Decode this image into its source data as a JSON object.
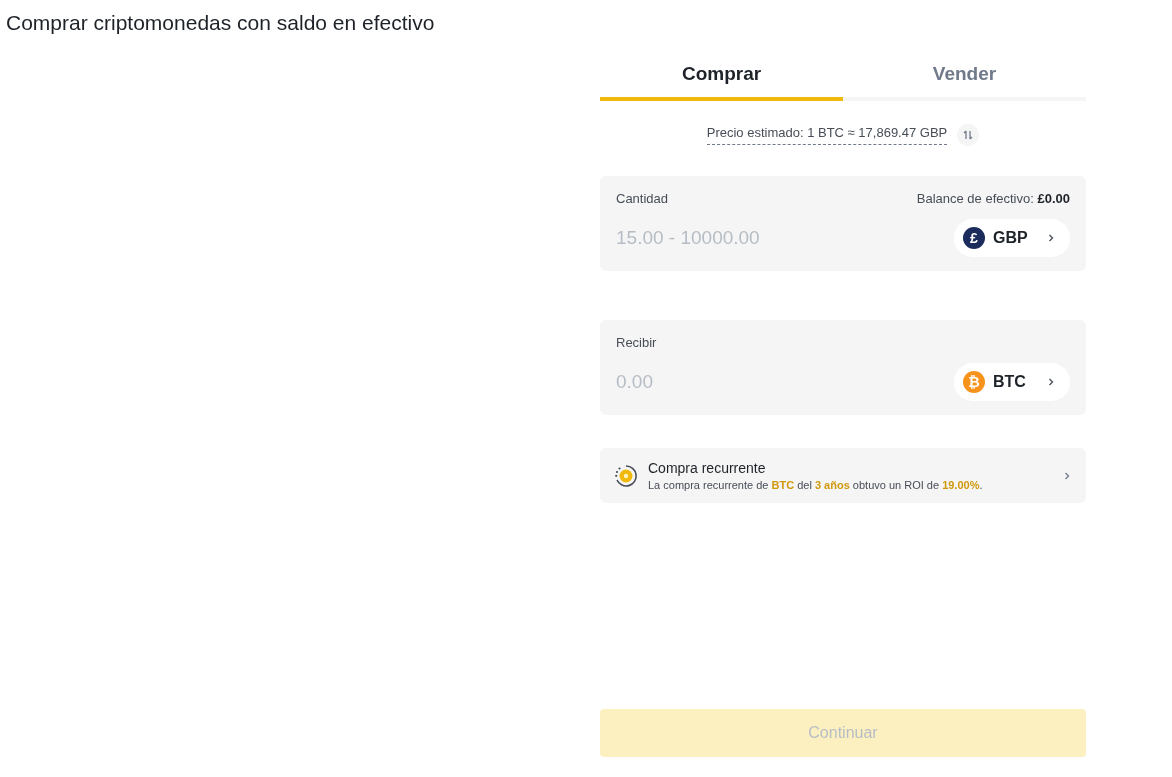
{
  "page_title": "Comprar criptomonedas con saldo en efectivo",
  "tabs": [
    {
      "label": "Comprar",
      "selected": true
    },
    {
      "label": "Vender",
      "selected": false
    }
  ],
  "price_estimate": "Precio estimado: 1 BTC ≈ 17,869.47 GBP",
  "amount_card": {
    "label": "Cantidad",
    "balance_label": "Balance de efectivo:",
    "balance_value": "£0.00",
    "placeholder": "15.00 - 10000.00",
    "currency": {
      "code": "GBP",
      "symbol": "£",
      "kind": "fiat"
    }
  },
  "receive_card": {
    "label": "Recibir",
    "placeholder": "0.00",
    "currency": {
      "code": "BTC",
      "symbol": "₿",
      "kind": "crypto"
    }
  },
  "recurring": {
    "title": "Compra recurrente",
    "description": "La compra recurrente de **BTC** del **3 años** obtuvo un ROI de **19.00%**."
  },
  "continue_button": {
    "label": "Continuar",
    "disabled": true
  }
}
